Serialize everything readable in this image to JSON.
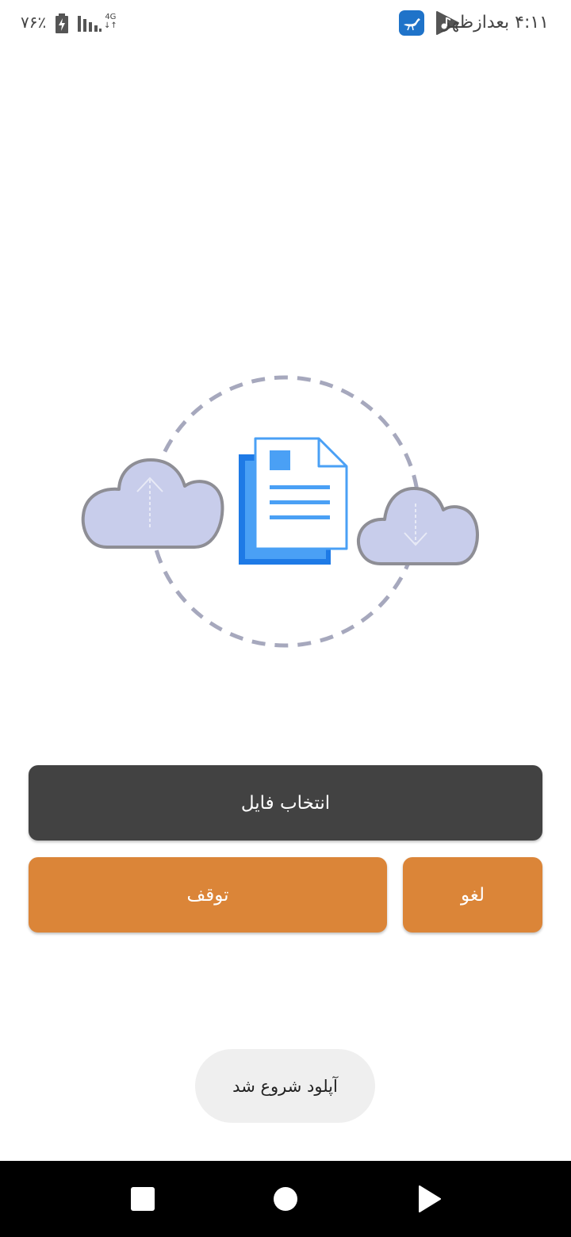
{
  "status_bar": {
    "time": "۴:۱۱ بعدازظهر",
    "battery": "۷۶٪",
    "network_top": "4G",
    "network_bottom": "↓↑",
    "icons": [
      "app-notification-icon",
      "music-icon",
      "battery-charging-icon",
      "signal-icon"
    ]
  },
  "illustration": {
    "description_icons": [
      "upload-cloud-icon",
      "document-icon",
      "download-cloud-icon"
    ],
    "colors": {
      "cloud_fill": "#c8cdeb",
      "cloud_stroke": "#8e8e95",
      "doc_blue": "#1e7ae6",
      "doc_light_blue": "#4aa0f5",
      "dashed_circle": "#a6a8bd"
    }
  },
  "buttons": {
    "select_file": "انتخاب فایل",
    "stop": "توقف",
    "cancel": "لغو"
  },
  "toast": {
    "message": "آپلود شروع شد"
  },
  "colors": {
    "dark_button": "#424242",
    "accent_orange": "#db8538"
  }
}
